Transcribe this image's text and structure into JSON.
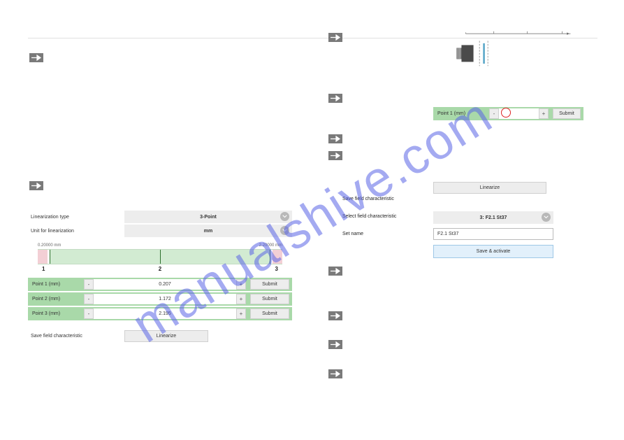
{
  "watermark": "manualshive.com",
  "left": {
    "labels": {
      "lin_type": "Linearization type",
      "unit": "Unit for linearization",
      "save_field": "Save field characteristic"
    },
    "selects": {
      "lin_type_value": "3-Point",
      "unit_value": "mm"
    },
    "scale": {
      "min": "0.20000 mm",
      "max": "2.20000 mm"
    },
    "nums": [
      "1",
      "2",
      "3"
    ],
    "points": [
      {
        "label": "Point 1 (mm)",
        "value": "0.207",
        "minus": "-",
        "plus": "+",
        "submit": "Submit"
      },
      {
        "label": "Point 2 (mm)",
        "value": "1.172",
        "minus": "-",
        "plus": "+",
        "submit": "Submit"
      },
      {
        "label": "Point 3 (mm)",
        "value": "2.195",
        "minus": "-",
        "plus": "+",
        "submit": "Submit"
      }
    ],
    "linearize_btn": "Linearize"
  },
  "rtop": {
    "point": {
      "label": "Point 1 (mm)",
      "minus": "-",
      "plus": "+",
      "submit": "Submit"
    }
  },
  "rbot": {
    "linearize_btn": "Linearize",
    "labels": {
      "save_field": "Save field characteristic",
      "select_field": "Select field characteristic",
      "set_name": "Set name"
    },
    "select_value": "3: F2.1 St37",
    "name_value": "F2.1 St37",
    "save_activate": "Save & activate"
  }
}
